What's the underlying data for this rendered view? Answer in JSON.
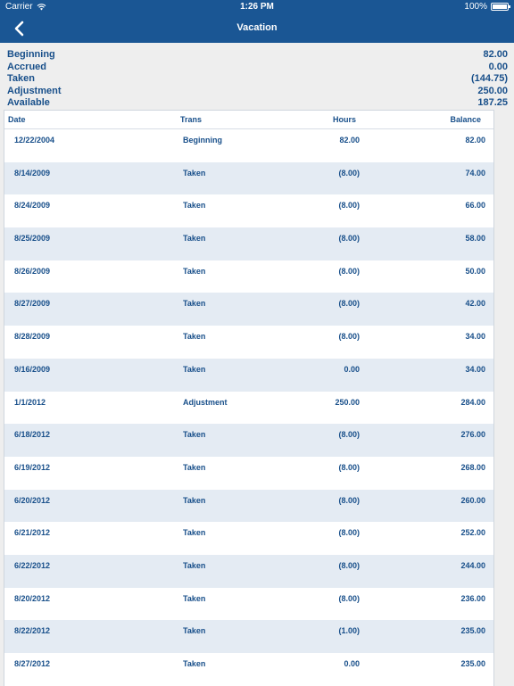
{
  "status_bar": {
    "carrier": "Carrier",
    "time": "1:26 PM",
    "battery": "100%"
  },
  "nav": {
    "title": "Vacation"
  },
  "summary": [
    {
      "label": "Beginning",
      "value": "82.00"
    },
    {
      "label": "Accrued",
      "value": "0.00"
    },
    {
      "label": "Taken",
      "value": "(144.75)"
    },
    {
      "label": "Adjustment",
      "value": "250.00"
    },
    {
      "label": "Available",
      "value": "187.25"
    }
  ],
  "table": {
    "headers": {
      "date": "Date",
      "trans": "Trans",
      "hours": "Hours",
      "balance": "Balance"
    },
    "rows": [
      {
        "date": "12/22/2004",
        "trans": "Beginning",
        "hours": "82.00",
        "balance": "82.00"
      },
      {
        "date": "8/14/2009",
        "trans": "Taken",
        "hours": "(8.00)",
        "balance": "74.00"
      },
      {
        "date": "8/24/2009",
        "trans": "Taken",
        "hours": "(8.00)",
        "balance": "66.00"
      },
      {
        "date": "8/25/2009",
        "trans": "Taken",
        "hours": "(8.00)",
        "balance": "58.00"
      },
      {
        "date": "8/26/2009",
        "trans": "Taken",
        "hours": "(8.00)",
        "balance": "50.00"
      },
      {
        "date": "8/27/2009",
        "trans": "Taken",
        "hours": "(8.00)",
        "balance": "42.00"
      },
      {
        "date": "8/28/2009",
        "trans": "Taken",
        "hours": "(8.00)",
        "balance": "34.00"
      },
      {
        "date": "9/16/2009",
        "trans": "Taken",
        "hours": "0.00",
        "balance": "34.00"
      },
      {
        "date": "1/1/2012",
        "trans": "Adjustment",
        "hours": "250.00",
        "balance": "284.00"
      },
      {
        "date": "6/18/2012",
        "trans": "Taken",
        "hours": "(8.00)",
        "balance": "276.00"
      },
      {
        "date": "6/19/2012",
        "trans": "Taken",
        "hours": "(8.00)",
        "balance": "268.00"
      },
      {
        "date": "6/20/2012",
        "trans": "Taken",
        "hours": "(8.00)",
        "balance": "260.00"
      },
      {
        "date": "6/21/2012",
        "trans": "Taken",
        "hours": "(8.00)",
        "balance": "252.00"
      },
      {
        "date": "6/22/2012",
        "trans": "Taken",
        "hours": "(8.00)",
        "balance": "244.00"
      },
      {
        "date": "8/20/2012",
        "trans": "Taken",
        "hours": "(8.00)",
        "balance": "236.00"
      },
      {
        "date": "8/22/2012",
        "trans": "Taken",
        "hours": "(1.00)",
        "balance": "235.00"
      },
      {
        "date": "8/27/2012",
        "trans": "Taken",
        "hours": "0.00",
        "balance": "235.00"
      }
    ]
  },
  "icons": {
    "back": "chevron-left-icon",
    "wifi": "wifi-icon",
    "battery": "battery-icon"
  },
  "colors": {
    "nav_bg": "#1a5694",
    "text": "#184f8a",
    "row_alt": "#e4ebf3"
  }
}
